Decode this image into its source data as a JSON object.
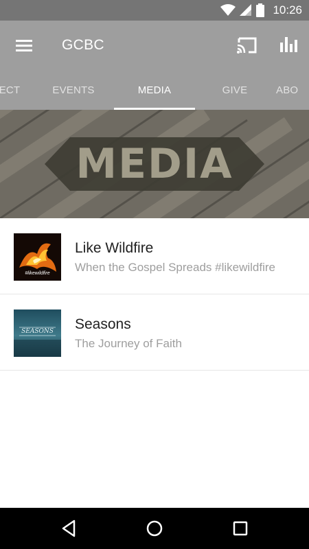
{
  "status_bar": {
    "time": "10:26",
    "icons": [
      "wifi-icon",
      "signal-icon",
      "battery-icon"
    ]
  },
  "app_bar": {
    "title": "GCBC",
    "icons": [
      "menu-icon",
      "cast-icon",
      "bar-chart-icon"
    ]
  },
  "tabs": [
    {
      "label": "ECT"
    },
    {
      "label": "EVENTS"
    },
    {
      "label": "MEDIA",
      "active": true
    },
    {
      "label": "GIVE"
    },
    {
      "label": "ABO"
    }
  ],
  "hero": {
    "text": "MEDIA"
  },
  "media_list": [
    {
      "title": "Like Wildfire",
      "subtitle": "When the Gospel Spreads #likewildfire",
      "thumb_text": "#likewildfire"
    },
    {
      "title": "Seasons",
      "subtitle": "The Journey of Faith",
      "thumb_text": "SEASONS"
    }
  ],
  "colors": {
    "app_bar": "#9e9e9e",
    "status_bar": "#757575",
    "nav_bar": "#000000"
  }
}
